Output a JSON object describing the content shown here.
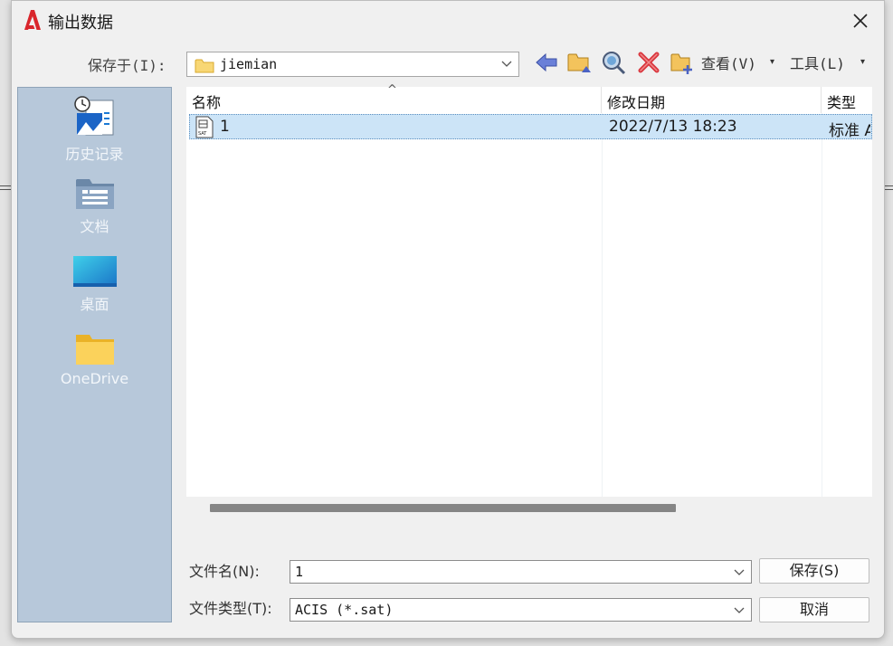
{
  "window": {
    "title": "输出数据"
  },
  "toolbar": {
    "save_in_label": "保存于(I):",
    "current_folder": "jiemian",
    "view_label": "查看(V)",
    "tools_label": "工具(L)",
    "drop_glyph": "▾"
  },
  "places": [
    {
      "label": "历史记录",
      "icon": "history-icon"
    },
    {
      "label": "文档",
      "icon": "documents-icon"
    },
    {
      "label": "桌面",
      "icon": "desktop-icon"
    },
    {
      "label": "OneDrive",
      "icon": "onedrive-folder-icon"
    }
  ],
  "file_list": {
    "columns": [
      "名称",
      "修改日期",
      "类型"
    ],
    "sort_glyph": "^",
    "rows": [
      {
        "name": "1",
        "date": "2022/7/13 18:23",
        "type": "标准 A"
      }
    ]
  },
  "form": {
    "filename_label": "文件名(N):",
    "filename_value": "1",
    "filetype_label": "文件类型(T):",
    "filetype_value": "ACIS (*.sat)",
    "save_button": "保存(S)",
    "cancel_button": "取消"
  },
  "colors": {
    "accent": "#cce4f7",
    "places_bg": "#b7c8da",
    "brand_red": "#d9262c"
  }
}
